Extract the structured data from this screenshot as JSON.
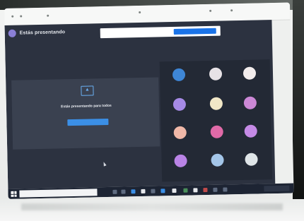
{
  "meeting": {
    "presenter_status": "Estás presentando",
    "banner_button_label": "",
    "present_message": "Estás presentando para todos",
    "stop_button_label": ""
  },
  "participants": [
    {
      "avatar_color": "#3e86d6"
    },
    {
      "avatar_color": "#e7e2e6"
    },
    {
      "avatar_color": "#f2ecec"
    },
    {
      "avatar_color": "#a68ae6"
    },
    {
      "avatar_color": "#f1e7c7"
    },
    {
      "avatar_color": "#cc88d6"
    },
    {
      "avatar_color": "#f0b8a8"
    },
    {
      "avatar_color": "#e06aa8"
    },
    {
      "avatar_color": "#c58ae6"
    },
    {
      "avatar_color": "#b983e6"
    },
    {
      "avatar_color": "#a3c5e8"
    },
    {
      "avatar_color": "#dfe5e8"
    }
  ],
  "colors": {
    "meeting_background": "#2c3240",
    "accent_blue": "#1a73e8",
    "taskbar": "#1d2433"
  }
}
